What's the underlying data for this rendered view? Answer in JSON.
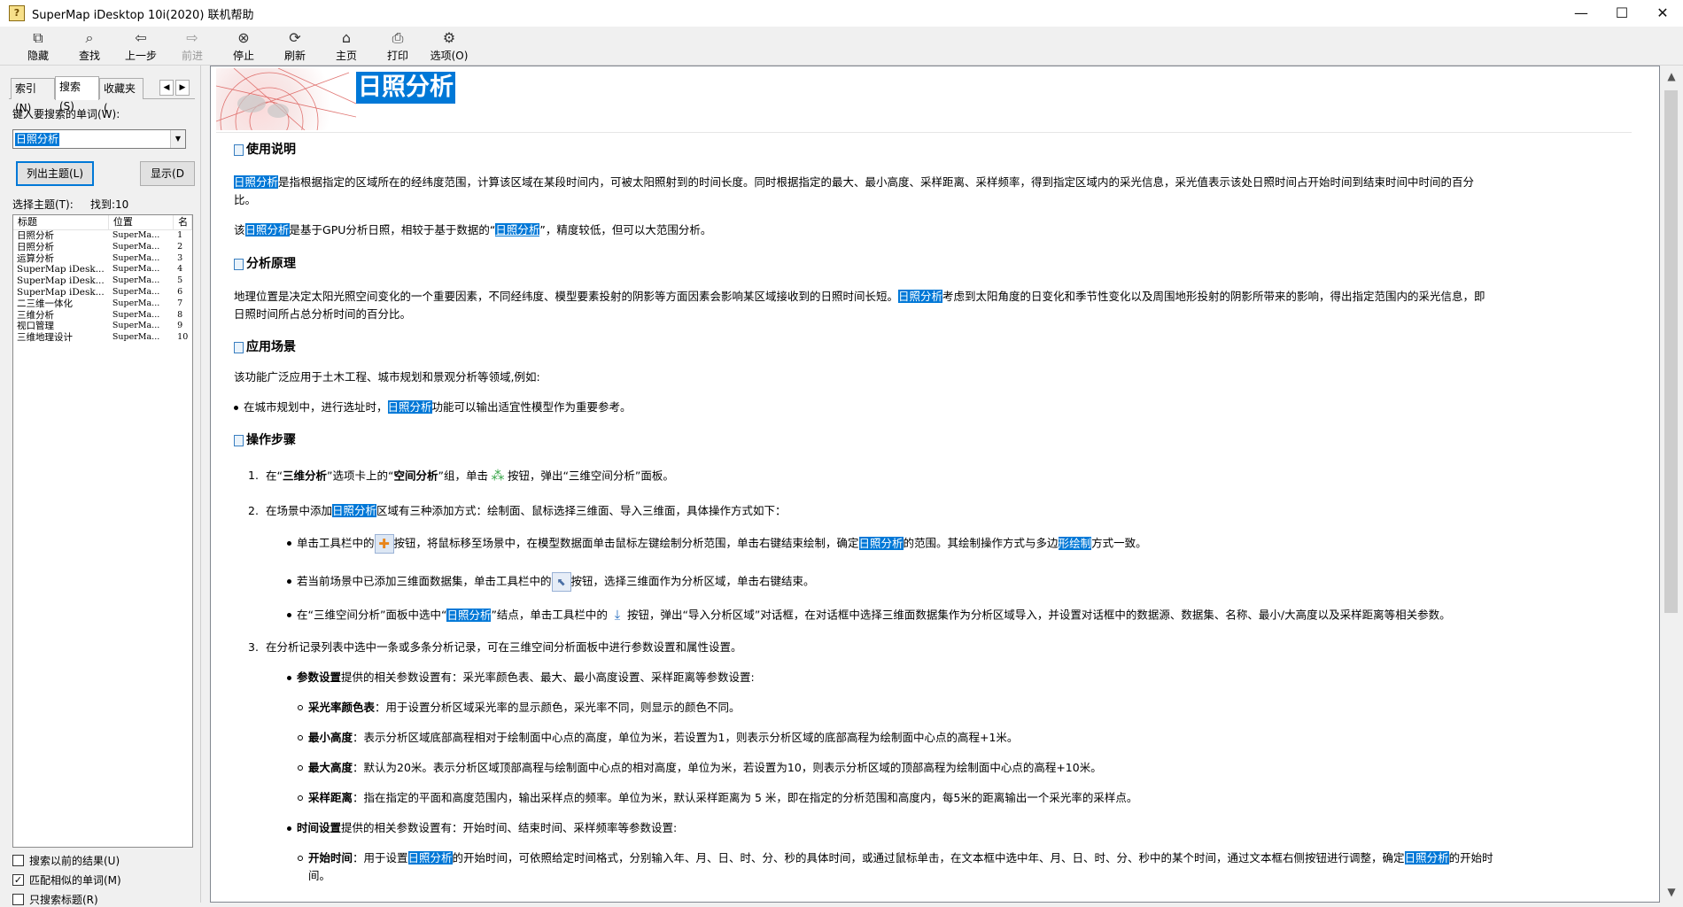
{
  "window": {
    "title": "SuperMap iDesktop 10i(2020) 联机帮助",
    "app_icon_glyph": "?",
    "controls": {
      "minimize": "—",
      "maximize": "☐",
      "close": "✕"
    }
  },
  "toolbar": [
    {
      "label": "隐藏",
      "icon": "hide-icon",
      "glyph": "⧉",
      "enabled": true
    },
    {
      "label": "查找",
      "icon": "find-icon",
      "glyph": "⌕",
      "enabled": true
    },
    {
      "label": "上一步",
      "icon": "back-arrow-icon",
      "glyph": "⇦",
      "enabled": true
    },
    {
      "label": "前进",
      "icon": "forward-arrow-icon",
      "glyph": "⇨",
      "enabled": false
    },
    {
      "label": "停止",
      "icon": "stop-icon",
      "glyph": "⊗",
      "enabled": true
    },
    {
      "label": "刷新",
      "icon": "refresh-icon",
      "glyph": "⟳",
      "enabled": true
    },
    {
      "label": "主页",
      "icon": "home-icon",
      "glyph": "⌂",
      "enabled": true
    },
    {
      "label": "打印",
      "icon": "print-icon",
      "glyph": "⎙",
      "enabled": true
    },
    {
      "label": "选项(O)",
      "icon": "options-icon",
      "glyph": "⚙",
      "enabled": true
    }
  ],
  "nav": {
    "tabs": [
      "索引(N)",
      "搜索(S)",
      "收藏夹("
    ],
    "active_tab": "搜索(S)",
    "tab_scroll_left": "◀",
    "tab_scroll_right": "▶",
    "search_label": "键入要搜索的单词(W):",
    "search_value": "日照分析",
    "combo_arrow": "▼",
    "list_topics_button": "列出主题(L)",
    "display_button": "显示(D",
    "select_topic_label": "选择主题(T):",
    "found_label": "找到:10",
    "columns": [
      "标题",
      "位置",
      "名"
    ],
    "results": [
      {
        "title": "日照分析",
        "location": "SuperMa...",
        "rank": "1"
      },
      {
        "title": "日照分析",
        "location": "SuperMa...",
        "rank": "2"
      },
      {
        "title": "运算分析",
        "location": "SuperMa...",
        "rank": "3"
      },
      {
        "title": "SuperMap iDesk...",
        "location": "SuperMa...",
        "rank": "4"
      },
      {
        "title": "SuperMap iDesk...",
        "location": "SuperMa...",
        "rank": "5"
      },
      {
        "title": "SuperMap iDesk...",
        "location": "SuperMa...",
        "rank": "6"
      },
      {
        "title": "二三维一体化",
        "location": "SuperMa...",
        "rank": "7"
      },
      {
        "title": "三维分析",
        "location": "SuperMa...",
        "rank": "8"
      },
      {
        "title": "视口管理",
        "location": "SuperMa...",
        "rank": "9"
      },
      {
        "title": "三维地理设计",
        "location": "SuperMa...",
        "rank": "10"
      }
    ],
    "checkboxes": [
      {
        "label": "搜索以前的结果(U)",
        "checked": false
      },
      {
        "label": "匹配相似的单词(M)",
        "checked": true
      },
      {
        "label": "只搜索标题(R)",
        "checked": false
      }
    ]
  },
  "scrollbar": {
    "up": "▲",
    "down": "▼"
  },
  "doc": {
    "title": "日照分析",
    "sections": {
      "usage": "使用说明",
      "principle": "分析原理",
      "scenario": "应用场景",
      "steps": "操作步骤"
    },
    "kw": "日照分析",
    "usage_p1_rest": "是指根据指定的区域所在的经纬度范围，计算该区域在某段时间内，可被太阳照射到的时间长度。同时根据指定的最大、最小高度、采样距离、采样频率，得到指定区域内的采光信息，采光值表示该处日照时间占开始时间到结束时间中时间的百分",
    "usage_p1_tail": "比。",
    "usage_p2_a": "该",
    "usage_p2_b": "是基于GPU分析日照，相较于基于数据的“",
    "usage_p2_c": "”，精度较低，但可以大范围分析。",
    "principle_a": "地理位置是决定太阳光照空间变化的一个重要因素，不同经纬度、模型要素投射的阴影等方面因素会影响某区域接收到的日照时间长短。",
    "principle_b": "考虑到太阳角度的日变化和季节性变化以及周围地形投射的阴影所带来的影响，得出指定范围内的采光信息，即",
    "principle_tail": "日照时间所占总分析时间的百分比。",
    "scenario_p": "该功能广泛应用于土木工程、城市规划和景观分析等领域,例如:",
    "scenario_b1_a": "在城市规划中，进行选址时，",
    "scenario_b1_b": "功能可以输出适宜性模型作为重要参考。",
    "step1_num": "1.",
    "step1_a": "在“",
    "step1_b": "三维分析",
    "step1_c": "”选项卡上的“",
    "step1_d": "空间分析",
    "step1_e": "”组，单击",
    "step1_f": "按钮，弹出“三维空间分析”面板。",
    "step2_num": "2.",
    "step2_a": "在场景中添加",
    "step2_b": "区域有三种添加方式：绘制面、鼠标选择三维面、导入三维面，具体操作方式如下：",
    "step2_s1_a": "单击工具栏中的",
    "step2_s1_b": "按钮，将鼠标移至场景中，在模型数据面单击鼠标左键绘制分析范围，单击右键结束绘制，确定",
    "step2_s1_c": "的范围。其绘制操作方式与多边",
    "step2_s1_d": "形绘制",
    "step2_s1_e": "方式一致。",
    "step2_s2_a": "若当前场景中已添加三维面数据集，单击工具栏中的",
    "step2_s2_b": "按钮，选择三维面作为分析区域，单击右键结束。",
    "step2_s3_a": "在“三维空间分析”面板中选中“",
    "step2_s3_b": "”结点，单击工具栏中的",
    "step2_s3_c": "按钮，弹出“导入分析区域”对话框，在对话框中选择三维面数据集作为分析区域导入，并设置对话框中的数据源、数据集、名称、最小/大高度以及采样距离等相关参数。",
    "step3_num": "3.",
    "step3": "在分析记录列表中选中一条或多条分析记录，可在三维空间分析面板中进行参数设置和属性设置。",
    "param_a": "参数设置",
    "param_b": "提供的相关参数设置有：采光率颜色表、最大、最小高度设置、采样距离等参数设置:",
    "p_color_a": "采光率颜色表",
    "p_color_b": "：用于设置分析区域采光率的显示颜色，采光率不同，则显示的颜色不同。",
    "p_min_a": "最小高度",
    "p_min_b": "：表示分析区域底部高程相对于绘制面中心点的高度，单位为米，若设置为1，则表示分析区域的底部高程为绘制面中心点的高程+1米。",
    "p_max_a": "最大高度",
    "p_max_b": "：默认为20米。表示分析区域顶部高程与绘制面中心点的相对高度，单位为米，若设置为10，则表示分析区域的顶部高程为绘制面中心点的高程+10米。",
    "p_dist_a": "采样距离",
    "p_dist_b": "：指在指定的平面和高度范围内，输出采样点的频率。单位为米，默认采样距离为 5 米，即在指定的分析范围和高度内，每5米的距离输出一个采光率的采样点。",
    "time_a": "时间设置",
    "time_b": "提供的相关参数设置有：开始时间、结束时间、采样频率等参数设置:",
    "t_start_a": "开始时间",
    "t_start_b": "：用于设置",
    "t_start_c": "的开始时间，可依照给定时间格式，分别输入年、月、日、时、分、秒的具体时间，或通过鼠标单击，在文本框中选中年、月、日、时、分、秒中的某个时间，通过文本框右侧按钮进行调整，确定",
    "t_start_d": "的开始时",
    "t_start_tail": "间。"
  }
}
